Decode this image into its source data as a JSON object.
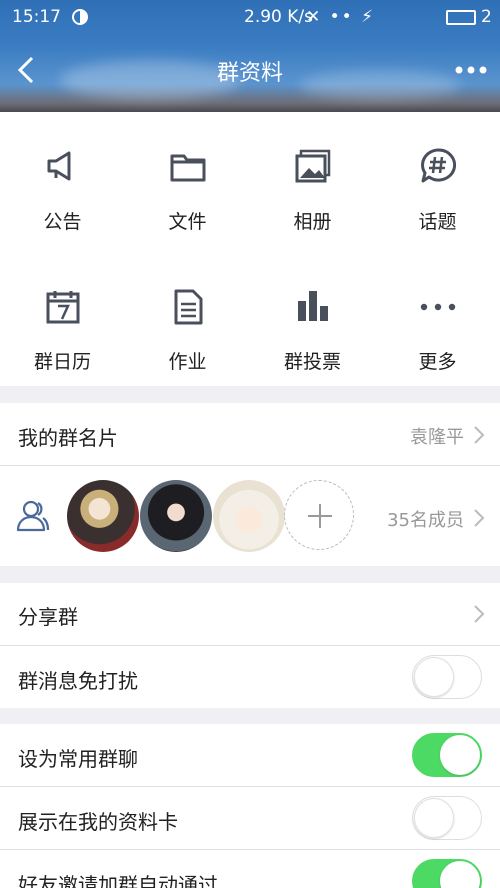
{
  "status_bar": {
    "time": "15:17",
    "net_speed": "2.90 K/s",
    "icons_text": "✕ •• ⚡",
    "battery_level": "2"
  },
  "nav": {
    "title": "群资料"
  },
  "grid": [
    {
      "label": "公告",
      "icon": "megaphone-icon"
    },
    {
      "label": "文件",
      "icon": "folder-icon"
    },
    {
      "label": "相册",
      "icon": "photo-album-icon"
    },
    {
      "label": "话题",
      "icon": "topic-hashtag-icon"
    },
    {
      "label": "群日历",
      "icon": "calendar-icon"
    },
    {
      "label": "作业",
      "icon": "homework-document-icon"
    },
    {
      "label": "群投票",
      "icon": "vote-chart-icon"
    },
    {
      "label": "更多",
      "icon": "more-dots-icon"
    }
  ],
  "card": {
    "label": "我的群名片",
    "value": "袁隆平"
  },
  "members": {
    "count_text": "35名成员"
  },
  "share": {
    "label": "分享群"
  },
  "settings": [
    {
      "label": "群消息免打扰",
      "on": false
    },
    {
      "label": "设为常用群聊",
      "on": true
    },
    {
      "label": "展示在我的资料卡",
      "on": false
    },
    {
      "label": "好友邀请加群自动通过",
      "on": true
    }
  ],
  "colors": {
    "accent_blue": "#3a7cc2",
    "toggle_on": "#4cd964",
    "icon_gray": "#4a4f5c"
  }
}
